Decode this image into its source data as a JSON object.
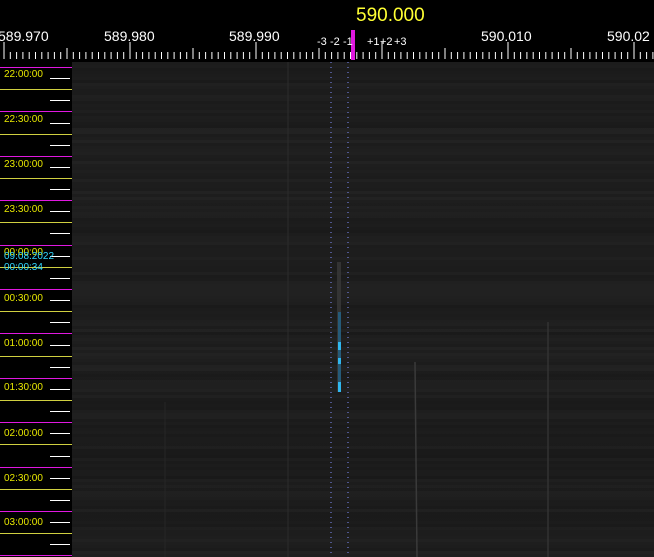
{
  "scale": {
    "center_frequency": "590.000",
    "frequency_labels": [
      "589.970",
      "589.980",
      "589.990",
      "590.010",
      "590.02"
    ],
    "offset_labels": [
      "-3",
      "-2",
      "-1",
      "+1",
      "+2",
      "+3"
    ]
  },
  "time_axis": {
    "labels": [
      "22:00:00",
      "22:30:00",
      "23:00:00",
      "23:30:00",
      "00:30:00",
      "01:00:00",
      "01:30:00",
      "02:00:00",
      "02:30:00",
      "03:00:00"
    ],
    "overlap_labels": [
      "00:00:00",
      "09.08.2022"
    ],
    "cursor_time": "00:00:34"
  },
  "colors": {
    "accent": "#e018e0",
    "time_text": "#e8e800",
    "date_text": "#30d8ff",
    "signal": "#1ea0e0"
  }
}
